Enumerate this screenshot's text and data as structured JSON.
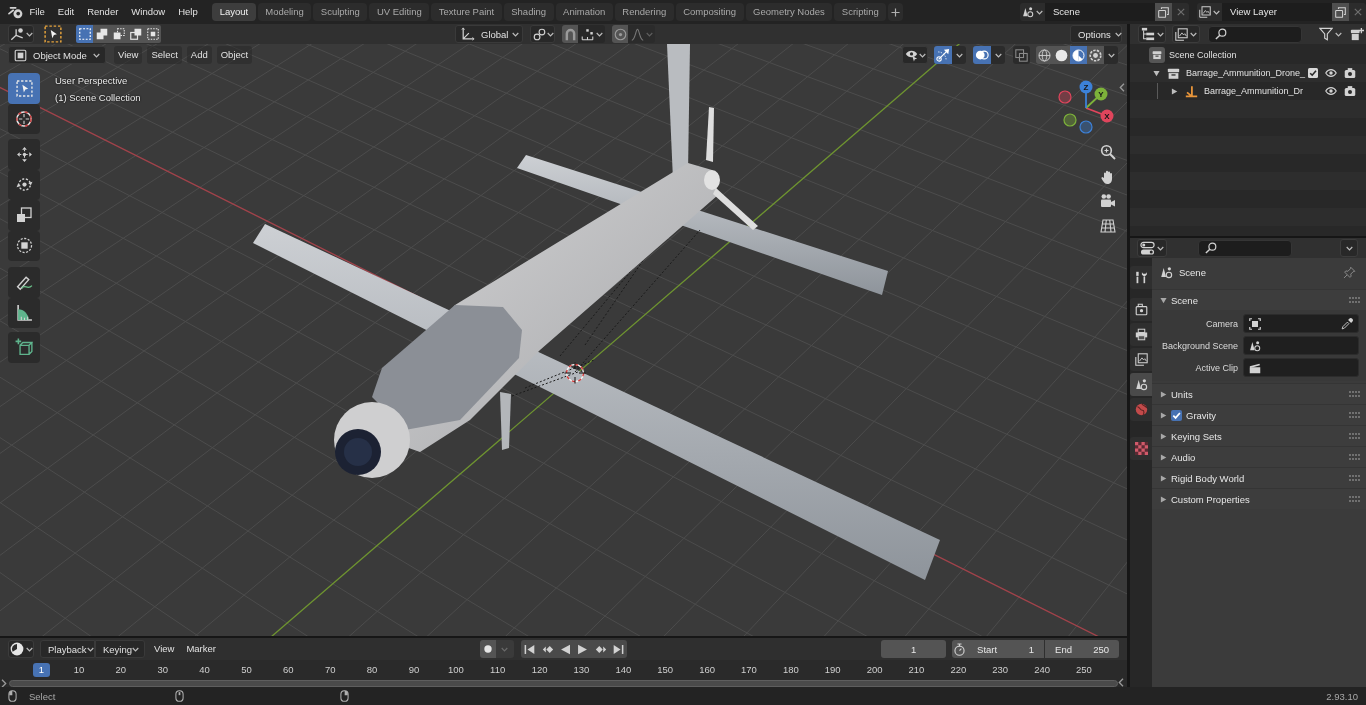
{
  "topbar": {
    "menus": [
      "File",
      "Edit",
      "Render",
      "Window",
      "Help"
    ],
    "workspaces": [
      {
        "label": "Layout",
        "selected": true
      },
      {
        "label": "Modeling",
        "selected": false
      },
      {
        "label": "Sculpting",
        "selected": false
      },
      {
        "label": "UV Editing",
        "selected": false
      },
      {
        "label": "Texture Paint",
        "selected": false
      },
      {
        "label": "Shading",
        "selected": false
      },
      {
        "label": "Animation",
        "selected": false
      },
      {
        "label": "Rendering",
        "selected": false
      },
      {
        "label": "Compositing",
        "selected": false
      },
      {
        "label": "Geometry Nodes",
        "selected": false
      },
      {
        "label": "Scripting",
        "selected": false
      }
    ],
    "scene": "Scene",
    "view_layer": "View Layer"
  },
  "viewport": {
    "select_modes": [
      {
        "selected": true
      },
      {
        "selected": false
      },
      {
        "selected": false
      },
      {
        "selected": false
      },
      {
        "selected": false
      }
    ],
    "orientation": "Global",
    "snap": {
      "on": false
    },
    "proportional": {
      "on": false
    },
    "options": "Options",
    "mode": "Object Mode",
    "menus": [
      "View",
      "Select",
      "Add",
      "Object"
    ],
    "gizmos": {
      "on": true
    },
    "overlays": {
      "on": true
    },
    "xray": {
      "on": false
    },
    "shading": [
      {
        "selected": false
      },
      {
        "selected": false
      },
      {
        "selected": true
      },
      {
        "selected": false
      }
    ],
    "tools": [
      {
        "selected": true
      },
      {
        "selected": false
      },
      {
        "selected": false
      },
      {
        "selected": false
      },
      {
        "selected": false
      },
      {
        "selected": false
      },
      {
        "selected": false
      },
      {
        "selected": false
      },
      {
        "selected": false
      }
    ],
    "info": [
      "User Perspective",
      "(1) Scene Collection"
    ],
    "axes": [
      {
        "label": "X",
        "color": "#e0455c"
      },
      {
        "label": "Y",
        "color": "#7db23a"
      },
      {
        "label": "Z",
        "color": "#3c81d8"
      }
    ]
  },
  "timeline": {
    "menus": [
      {
        "label": "Playback",
        "kind": "dropdown"
      },
      {
        "label": "Keying",
        "kind": "dropdown"
      },
      {
        "label": "View",
        "kind": "menu"
      },
      {
        "label": "Marker",
        "kind": "menu"
      }
    ],
    "auto_keying": {
      "on": false
    },
    "current_frame": "1",
    "start": {
      "label": "Start",
      "value": "1"
    },
    "end": {
      "label": "End",
      "value": "250"
    },
    "playhead": "1",
    "ruler": [
      "10",
      "20",
      "30",
      "40",
      "50",
      "60",
      "70",
      "80",
      "90",
      "100",
      "110",
      "120",
      "130",
      "140",
      "150",
      "160",
      "170",
      "180",
      "190",
      "200",
      "210",
      "220",
      "230",
      "240",
      "250"
    ]
  },
  "outliner": {
    "tree": [
      {
        "kind": "scene",
        "label": "Scene Collection",
        "children": [
          {
            "kind": "collection",
            "label": "Barrage_Ammunition_Drone_",
            "expanded": true,
            "checked": true,
            "visible": true,
            "renderable": true,
            "children": [
              {
                "kind": "object",
                "label": "Barrage_Ammunition_Dr",
                "expanded": false,
                "visible": true,
                "renderable": true
              }
            ]
          }
        ]
      }
    ]
  },
  "properties": {
    "tabs": [
      {
        "selected": false
      },
      {
        "selected": false
      },
      {
        "selected": false
      },
      {
        "selected": false
      },
      {
        "selected": true
      },
      {
        "selected": false
      },
      {
        "selected": false
      }
    ],
    "context": "Scene",
    "panels": [
      {
        "kind": "plain",
        "title": "Scene",
        "expanded": true,
        "fields": [
          {
            "kind": "object",
            "label": "Camera"
          },
          {
            "kind": "scene",
            "label": "Background Scene"
          },
          {
            "kind": "clip",
            "label": "Active Clip"
          }
        ]
      },
      {
        "kind": "plain",
        "title": "Units",
        "expanded": false
      },
      {
        "kind": "toggle",
        "title": "Gravity",
        "expanded": false,
        "checked": true
      },
      {
        "kind": "plain",
        "title": "Keying Sets",
        "expanded": false
      },
      {
        "kind": "plain",
        "title": "Audio",
        "expanded": false
      },
      {
        "kind": "plain",
        "title": "Rigid Body World",
        "expanded": false
      },
      {
        "kind": "plain",
        "title": "Custom Properties",
        "expanded": false
      }
    ]
  },
  "status_bar": {
    "hint": "Select",
    "version": "2.93.10"
  }
}
